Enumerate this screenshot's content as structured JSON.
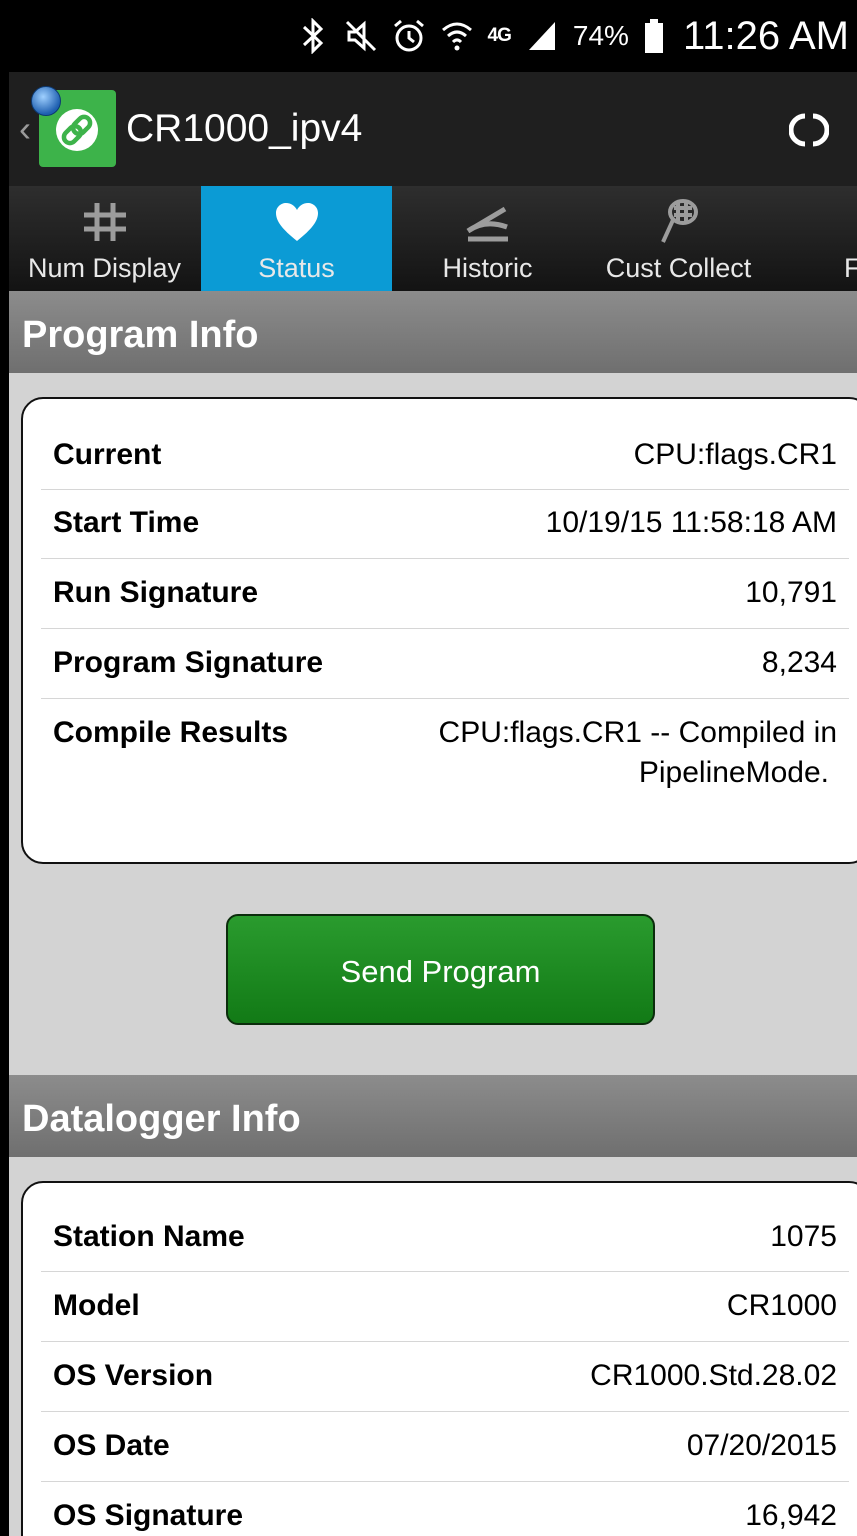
{
  "status_bar": {
    "network": "4G",
    "battery": "74%",
    "time": "11:26 AM"
  },
  "action_bar": {
    "title": "CR1000_ipv4"
  },
  "tabs": [
    {
      "label": "Num Display",
      "active": false
    },
    {
      "label": "Status",
      "active": true
    },
    {
      "label": "Historic",
      "active": false
    },
    {
      "label": "Cust Collect",
      "active": false
    },
    {
      "label": "F",
      "active": false
    }
  ],
  "program_info": {
    "heading": "Program Info",
    "rows": [
      {
        "label": "Current",
        "value": "CPU:flags.CR1"
      },
      {
        "label": "Start Time",
        "value": "10/19/15 11:58:18 AM"
      },
      {
        "label": "Run Signature",
        "value": "10,791"
      },
      {
        "label": "Program Signature",
        "value": "8,234"
      },
      {
        "label": "Compile Results",
        "value_line1": "CPU:flags.CR1 -- Compiled in",
        "value_line2": "PipelineMode."
      }
    ],
    "button_label": "Send Program"
  },
  "datalogger_info": {
    "heading": "Datalogger Info",
    "rows": [
      {
        "label": "Station Name",
        "value": "1075"
      },
      {
        "label": "Model",
        "value": "CR1000"
      },
      {
        "label": "OS Version",
        "value": "CR1000.Std.28.02"
      },
      {
        "label": "OS Date",
        "value": "07/20/2015"
      },
      {
        "label": "OS Signature",
        "value": "16,942"
      }
    ]
  },
  "colors": {
    "accent_tab": "#0b9bd5",
    "button_green": "#1a8a1e",
    "app_icon_green": "#3db34a"
  }
}
